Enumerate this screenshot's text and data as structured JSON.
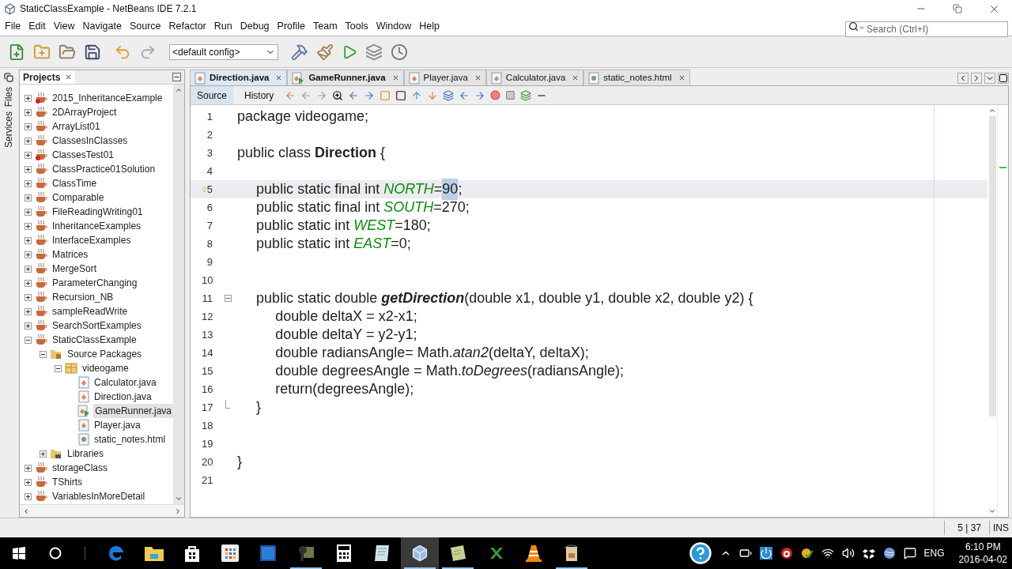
{
  "window": {
    "title": "StaticClassExample - NetBeans IDE 7.2.1"
  },
  "menu": [
    "File",
    "Edit",
    "View",
    "Navigate",
    "Source",
    "Refactor",
    "Run",
    "Debug",
    "Profile",
    "Team",
    "Tools",
    "Window",
    "Help"
  ],
  "search": {
    "placeholder": "Search (Ctrl+I)"
  },
  "toolbar": {
    "config": "<default config>"
  },
  "side_tabs": [
    "Files",
    "Services"
  ],
  "projects": {
    "title": "Projects",
    "tree": [
      {
        "label": "2015_InheritanceExample",
        "kind": "project-error",
        "expanded": false,
        "selected": false
      },
      {
        "label": "2DArrayProject",
        "kind": "project",
        "expanded": false,
        "selected": false
      },
      {
        "label": "ArrayList01",
        "kind": "project",
        "expanded": false,
        "selected": false
      },
      {
        "label": "ClassesInClasses",
        "kind": "project",
        "expanded": false,
        "selected": false
      },
      {
        "label": "ClassesTest01",
        "kind": "project-error",
        "expanded": false,
        "selected": false
      },
      {
        "label": "ClassPractice01Solution",
        "kind": "project",
        "expanded": false,
        "selected": false
      },
      {
        "label": "ClassTime",
        "kind": "project",
        "expanded": false,
        "selected": false
      },
      {
        "label": "Comparable",
        "kind": "project",
        "expanded": false,
        "selected": false
      },
      {
        "label": "FileReadingWriting01",
        "kind": "project",
        "expanded": false,
        "selected": false
      },
      {
        "label": "InheritanceExamples",
        "kind": "project",
        "expanded": false,
        "selected": false
      },
      {
        "label": "InterfaceExamples",
        "kind": "project",
        "expanded": false,
        "selected": false
      },
      {
        "label": "Matrices",
        "kind": "project",
        "expanded": false,
        "selected": false
      },
      {
        "label": "MergeSort",
        "kind": "project",
        "expanded": false,
        "selected": false
      },
      {
        "label": "ParameterChanging",
        "kind": "project",
        "expanded": false,
        "selected": false
      },
      {
        "label": "Recursion_NB",
        "kind": "project",
        "expanded": false,
        "selected": false
      },
      {
        "label": "sampleReadWrite",
        "kind": "project",
        "expanded": false,
        "selected": false
      },
      {
        "label": "SearchSortExamples",
        "kind": "project",
        "expanded": false,
        "selected": false
      },
      {
        "label": "StaticClassExample",
        "kind": "project",
        "expanded": true,
        "selected": false,
        "children": [
          {
            "label": "Source Packages",
            "kind": "source-folder",
            "expanded": true,
            "selected": false,
            "children": [
              {
                "label": "videogame",
                "kind": "package",
                "expanded": true,
                "selected": false,
                "children": [
                  {
                    "label": "Calculator.java",
                    "kind": "java",
                    "selected": false
                  },
                  {
                    "label": "Direction.java",
                    "kind": "java",
                    "selected": false
                  },
                  {
                    "label": "GameRunner.java",
                    "kind": "java-main",
                    "selected": true
                  },
                  {
                    "label": "Player.java",
                    "kind": "java",
                    "selected": false
                  },
                  {
                    "label": "static_notes.html",
                    "kind": "html",
                    "selected": false
                  }
                ]
              }
            ]
          },
          {
            "label": "Libraries",
            "kind": "libraries",
            "expanded": false,
            "selected": false
          }
        ]
      },
      {
        "label": "storageClass",
        "kind": "project",
        "expanded": false,
        "selected": false
      },
      {
        "label": "TShirts",
        "kind": "project",
        "expanded": false,
        "selected": false
      },
      {
        "label": "VariablesInMoreDetail",
        "kind": "project",
        "expanded": false,
        "selected": false
      }
    ]
  },
  "editor": {
    "tabs": [
      {
        "label": "Direction.java",
        "kind": "java",
        "selected": true,
        "bold": true
      },
      {
        "label": "GameRunner.java",
        "kind": "java-main",
        "selected": false,
        "bold": true
      },
      {
        "label": "Player.java",
        "kind": "java",
        "selected": false,
        "bold": false
      },
      {
        "label": "Calculator.java",
        "kind": "java",
        "selected": false,
        "bold": false
      },
      {
        "label": "static_notes.html",
        "kind": "html",
        "selected": false,
        "bold": false
      }
    ],
    "views": [
      {
        "label": "Source",
        "selected": true
      },
      {
        "label": "History",
        "selected": false
      }
    ],
    "lines": [
      {
        "number": "1",
        "tokens": [
          {
            "kind": "plain",
            "text": "package videogame;"
          }
        ]
      },
      {
        "number": "2"
      },
      {
        "number": "3",
        "tokens": [
          {
            "kind": "plain",
            "text": "public class "
          },
          {
            "kind": "class",
            "text": "Direction"
          },
          {
            "kind": "plain",
            "text": " {"
          }
        ]
      },
      {
        "number": "4"
      },
      {
        "number": "5",
        "current": true,
        "hint": true,
        "tokens": [
          {
            "kind": "plain",
            "text": "    public static final int "
          },
          {
            "kind": "field",
            "text": "NORTH"
          },
          {
            "kind": "plain",
            "text": "="
          },
          {
            "kind": "selected",
            "text": "90"
          },
          {
            "kind": "plain",
            "text": ";"
          }
        ]
      },
      {
        "number": "6",
        "tokens": [
          {
            "kind": "plain",
            "text": "    public static final int "
          },
          {
            "kind": "field",
            "text": "SOUTH"
          },
          {
            "kind": "plain",
            "text": "=270;"
          }
        ]
      },
      {
        "number": "7",
        "tokens": [
          {
            "kind": "plain",
            "text": "    public static int "
          },
          {
            "kind": "field",
            "text": "WEST"
          },
          {
            "kind": "plain",
            "text": "=180;"
          }
        ]
      },
      {
        "number": "8",
        "tokens": [
          {
            "kind": "plain",
            "text": "    public static int "
          },
          {
            "kind": "field",
            "text": "EAST"
          },
          {
            "kind": "plain",
            "text": "=0;"
          }
        ]
      },
      {
        "number": "9"
      },
      {
        "number": "10"
      },
      {
        "number": "11",
        "fold_start": true,
        "tokens": [
          {
            "kind": "plain",
            "text": "    public static double "
          },
          {
            "kind": "method",
            "text": "getDirection"
          },
          {
            "kind": "plain",
            "text": "(double x1, double y1, double x2, double y2) {"
          }
        ]
      },
      {
        "number": "12",
        "tokens": [
          {
            "kind": "plain",
            "text": "        double deltaX = x2-x1;"
          }
        ]
      },
      {
        "number": "13",
        "tokens": [
          {
            "kind": "plain",
            "text": "        double deltaY = y2-y1;"
          }
        ]
      },
      {
        "number": "14",
        "tokens": [
          {
            "kind": "plain",
            "text": "        double radiansAngle= Math."
          },
          {
            "kind": "static",
            "text": "atan2"
          },
          {
            "kind": "plain",
            "text": "(deltaY, deltaX);"
          }
        ]
      },
      {
        "number": "15",
        "tokens": [
          {
            "kind": "plain",
            "text": "        double degreesAngle = Math."
          },
          {
            "kind": "static",
            "text": "toDegrees"
          },
          {
            "kind": "plain",
            "text": "(radiansAngle);"
          }
        ]
      },
      {
        "number": "16",
        "tokens": [
          {
            "kind": "plain",
            "text": "        return(degreesAngle);"
          }
        ]
      },
      {
        "number": "17",
        "fold_end": true,
        "tokens": [
          {
            "kind": "plain",
            "text": "    }"
          }
        ]
      },
      {
        "number": "18"
      },
      {
        "number": "19"
      },
      {
        "number": "20",
        "tokens": [
          {
            "kind": "plain",
            "text": "}"
          }
        ]
      },
      {
        "number": "21"
      }
    ]
  },
  "status_bar": {
    "position": "5 | 37",
    "mode": "INS"
  },
  "taskbar": {
    "apps": [
      {
        "kind": "edge",
        "running": false,
        "selected": false
      },
      {
        "kind": "folder",
        "running": false,
        "selected": false
      },
      {
        "kind": "store",
        "running": false,
        "selected": false
      },
      {
        "kind": "grid",
        "running": false,
        "selected": false
      },
      {
        "kind": "photo",
        "running": false,
        "selected": false
      },
      {
        "kind": "java",
        "running": true,
        "selected": false
      },
      {
        "kind": "calculator",
        "running": false,
        "selected": false
      },
      {
        "kind": "notepad",
        "running": false,
        "selected": false
      },
      {
        "kind": "cube",
        "running": true,
        "selected": true
      },
      {
        "kind": "note",
        "running": true,
        "selected": false
      },
      {
        "kind": "excel",
        "running": false,
        "selected": false
      },
      {
        "kind": "cone",
        "running": false,
        "selected": false
      },
      {
        "kind": "card",
        "running": true,
        "selected": false
      }
    ],
    "language": "ENG",
    "time": "6:10 PM",
    "date": "2016-04-02"
  }
}
